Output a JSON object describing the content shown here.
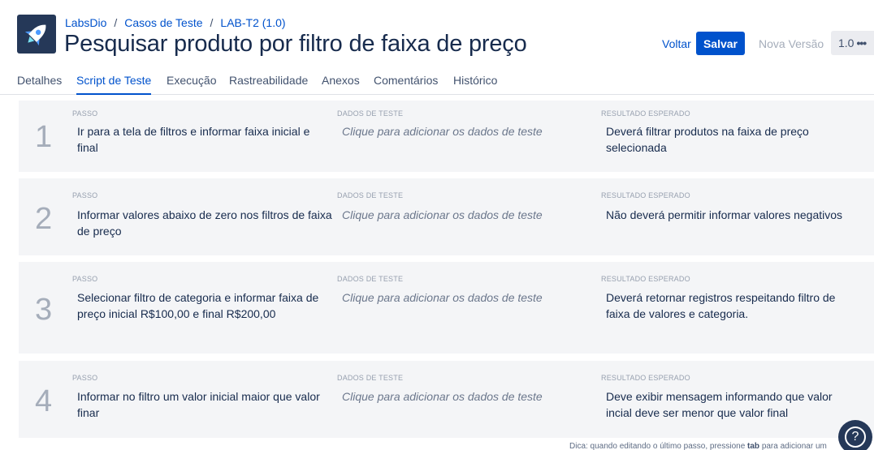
{
  "header": {
    "breadcrumb": [
      {
        "label": "LabsDio"
      },
      {
        "label": "Casos de Teste"
      },
      {
        "label": "LAB-T2 (1.0)"
      }
    ],
    "breadcrumb_separator": "/",
    "title": "Pesquisar produto por filtro de faixa de preço",
    "actions": {
      "back_label": "Voltar",
      "save_label": "Salvar",
      "new_version_label": "Nova Versão",
      "version_label": "1.0",
      "more_label": "•••"
    }
  },
  "tabs": [
    {
      "label": "Detalhes",
      "active": false
    },
    {
      "label": "Script de Teste",
      "active": true
    },
    {
      "label": "Execução",
      "active": false
    },
    {
      "label": "Rastreabilidade",
      "active": false
    },
    {
      "label": "Anexos",
      "active": false
    },
    {
      "label": "Comentários",
      "active": false
    },
    {
      "label": "Histórico",
      "active": false
    }
  ],
  "steps": {
    "column_labels": {
      "step": "PASSO",
      "test_data": "DADOS DE TESTE",
      "expected": "RESULTADO ESPERADO"
    },
    "items": [
      {
        "number": "1",
        "step_lines": [
          "Ir para a tela de filtros e informar faixa inicial e",
          "final"
        ],
        "test_data": "Clique para adicionar os dados de teste",
        "expected_lines": [
          "Deverá filtrar produtos na faixa de preço",
          "selecionada"
        ]
      },
      {
        "number": "2",
        "step_lines": [
          "Informar valores abaixo de zero nos filtros de faixa",
          "de preço"
        ],
        "test_data": "Clique para adicionar os dados de teste",
        "expected_lines": [
          "Não deverá permitir informar valores negativos",
          ""
        ]
      },
      {
        "number": "3",
        "step_lines": [
          "Selecionar filtro de categoria e informar faixa de",
          "preço inicial R$100,00 e final R$200,00"
        ],
        "test_data": "Clique para adicionar os dados de teste",
        "expected_lines": [
          "Deverá retornar registros respeitando filtro de",
          "faixa de valores e categoria."
        ]
      },
      {
        "number": "4",
        "step_lines": [
          "Informar no filtro um valor inicial maior que valor",
          "finar"
        ],
        "test_data": "Clique para adicionar os dados de teste",
        "expected_lines": [
          "Deve exibir mensagem informando que valor",
          "incial deve ser menor que valor final"
        ]
      }
    ]
  },
  "footer": {
    "tip_prefix": "Dica: quando editando o último passo, pressione",
    "tip_key": "tab",
    "tip_suffix": "para adicionar um"
  },
  "icons": {
    "project_avatar": "rocket-icon",
    "help": "question-mark-icon"
  },
  "colors": {
    "primary": "#0052cc",
    "avatar_bg": "#253858",
    "card_bg": "#f4f5f7"
  }
}
